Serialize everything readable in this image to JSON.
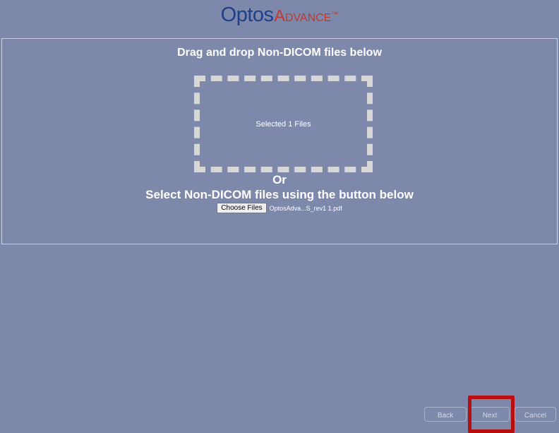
{
  "header": {
    "brand": "Optos",
    "product": "Advance",
    "trademark": "™"
  },
  "upload": {
    "drag_title": "Drag and drop Non-DICOM files below",
    "dropzone_status": "Selected 1 Files",
    "or_label": "Or",
    "select_title": "Select Non-DICOM files using the button below",
    "choose_button": "Choose Files",
    "file_name": "OptosAdva...S_rev1 1.pdf"
  },
  "footer": {
    "back": "Back",
    "next": "Next",
    "cancel": "Cancel"
  },
  "colors": {
    "background": "#7d88ab",
    "brand_blue": "#1f3f8a",
    "brand_red": "#c0392b",
    "highlight_red": "#b80e0e",
    "dropzone_border": "#d7d7d7"
  }
}
